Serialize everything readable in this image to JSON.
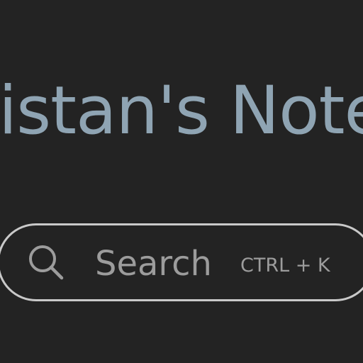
{
  "header": {
    "title": "istan's Notes"
  },
  "search": {
    "icon": "search-icon",
    "placeholder": "Search",
    "shortcut": "CTRL + K"
  },
  "colors": {
    "background": "#232323",
    "title": "#8fa4b3",
    "search_border": "#c9c9c9",
    "search_text": "#9c9c9c"
  }
}
